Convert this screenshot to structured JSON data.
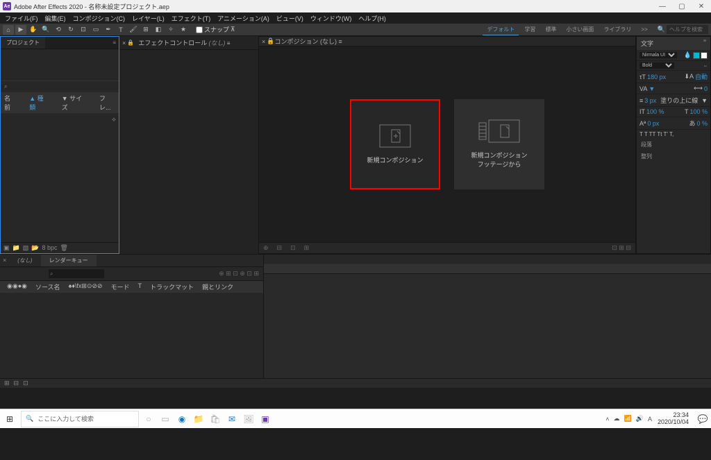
{
  "titlebar": {
    "logo": "Ae",
    "title": "Adobe After Effects 2020 - 名称未設定プロジェクト.aep"
  },
  "menubar": [
    "ファイル(F)",
    "編集(E)",
    "コンポジション(C)",
    "レイヤー(L)",
    "エフェクト(T)",
    "アニメーション(A)",
    "ビュー(V)",
    "ウィンドウ(W)",
    "ヘルプ(H)"
  ],
  "toolbar": {
    "snap_label": "スナップ",
    "workspaces": [
      "デフォルト",
      "学習",
      "標準",
      "小さい画面",
      "ライブラリ"
    ],
    "more": ">>",
    "help_placeholder": "ヘルプを検索"
  },
  "project": {
    "tab": "プロジェクト",
    "search_placeholder": "⌕",
    "cols": {
      "name": "名前",
      "type": "▲ 種類",
      "size": "▼ サイズ",
      "fre": "フレ..."
    },
    "footer": "8 bpc"
  },
  "effectctl": {
    "lock": "🔒",
    "title": "エフェクトコントロール",
    "none": "(なし)"
  },
  "composition": {
    "title": "コンポジション",
    "none": "(なし)",
    "card1": "新規コンポジション",
    "card2_l1": "新規コンポジション",
    "card2_l2": "フッテージから"
  },
  "charpanel": {
    "title": "文字",
    "font": "Nirmala UI",
    "weight": "Bold",
    "size_val": "180 px",
    "auto": "自動",
    "leading": "0",
    "tracking": "3 px",
    "stroke_label": "塗りの上に線",
    "pct1": "100 %",
    "pct2": "100 %",
    "px1": "0 px",
    "px2": "0 %",
    "typemodes": "T  T  TT  Tt  T'  T,",
    "para1": "段落",
    "para2": "整列"
  },
  "timeline": {
    "tab_none": "(なし)",
    "tab_render": "レンダーキュー",
    "cols": [
      "⌕",
      "ソース名",
      "♠♦\\fx⊞⊙⊘⊘",
      "モード",
      "T",
      "トラックマット",
      "親とリンク"
    ]
  },
  "taskbar": {
    "search": "ここに入力して検索",
    "clock_time": "23:34",
    "clock_date": "2020/10/04"
  },
  "colors": {
    "fill": "#00b8d4",
    "stroke": "#ffffff"
  }
}
